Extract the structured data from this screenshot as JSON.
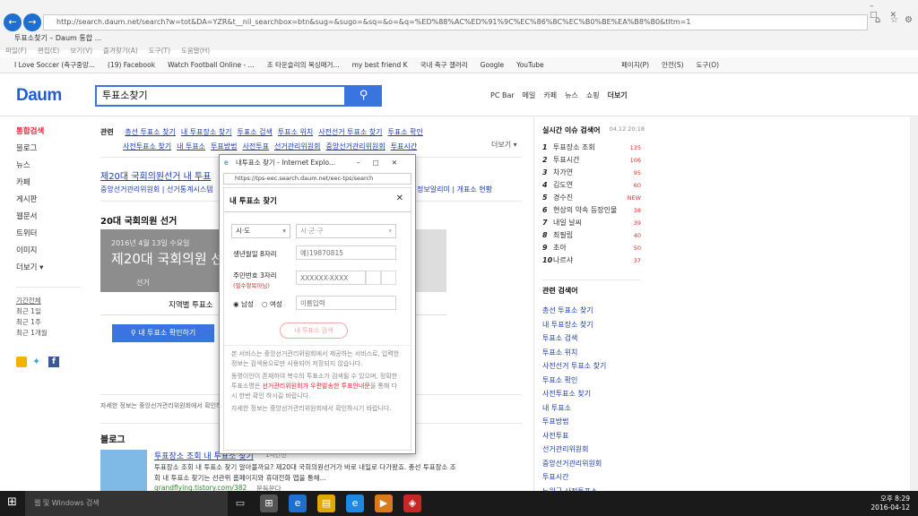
{
  "browser": {
    "url": "http://search.daum.net/search?w=tot&DA=YZR&t__nil_searchbox=btn&sug=&sugo=&sq=&o=&q=%ED%88%AC%ED%91%9C%EC%86%8C%EC%B0%BE%EA%B8%B0&tltm=1",
    "tab_title": "투표소찾기 – Daum 통합 ...",
    "menu": [
      "파일(F)",
      "편집(E)",
      "보기(V)",
      "즐겨찾기(A)",
      "도구(T)",
      "도움말(H)"
    ],
    "favorites": [
      "I Love Soccer (축구중앙...",
      "(19) Facebook",
      "Watch Football Online - ...",
      "조 타운슬리의 복싱매거...",
      "my best friend K",
      "국내 축구 갤러리",
      "Google",
      "YouTube"
    ],
    "commandbar": [
      "페이지(P)",
      "안전(S)",
      "도구(O)"
    ]
  },
  "daum": {
    "logo": "Daum",
    "query": "투표소찾기",
    "topnav": [
      "PC Bar",
      "메일",
      "카페",
      "뉴스",
      "쇼핑",
      "더보기"
    ],
    "leftnav": [
      "통합검색",
      "블로그",
      "뉴스",
      "카페",
      "게시판",
      "웹문서",
      "트위터",
      "이미지",
      "더보기"
    ],
    "period_title": "기간전체",
    "periods": [
      "최근 1일",
      "최근 1주",
      "최근 1개월"
    ],
    "related_label": "관련",
    "related_row1": [
      "총선 투표소 찾기",
      "내 투표장소 찾기",
      "투표소 검색",
      "투표소 위치",
      "사전선거 투표소 찾기",
      "투표소 확인"
    ],
    "related_row2": [
      "사전투표소 찾기",
      "내 투표소",
      "투표방법",
      "사전투표",
      "선거관리위원회",
      "중앙선거관리위원회",
      "투표시간"
    ],
    "more": "더보기",
    "result_title": "제20대 국회의원선거 내 투표",
    "result_sub": "중앙선거관리위원회 | 선거통계시스템",
    "result_sub_right": "정보알리미 | 개표소 현황",
    "section_title": "20대 국회의원 선거",
    "banner_date": "2016년 4월 13일 수요일",
    "banner_title": "제20대 국회의원 선",
    "banner_tab": "선거",
    "tab_local": "지역별 투표소",
    "find_btn": "내 투표소 확인하기",
    "footnote": "자세한 정보는 중앙선거관리위원회에서 확인하",
    "blog_title": "블로그",
    "blog_link": "투표장소 조회 내 투표소 찾기",
    "blog_meta": "1시간전",
    "blog_text1": "투표장소 조회 내 투표소 찾기 알아볼까요? 제20대 국회의원선거가 바로 내일로 다가왔죠. 총선 투표장소 조",
    "blog_text2": "회 내 투표소 찾기는 선관위 홈페이지와 휴대전화 앱을 통해...",
    "blog_url": "grandflying.tistory.com/382",
    "blog_more": "문득문다"
  },
  "realtime": {
    "title": "실시간 이슈 검색어",
    "time": "04.12  20:18",
    "items": [
      {
        "rank": "1",
        "word": "투표장소 조회",
        "val": "135"
      },
      {
        "rank": "2",
        "word": "투표시간",
        "val": "106"
      },
      {
        "rank": "3",
        "word": "차가연",
        "val": "95"
      },
      {
        "rank": "4",
        "word": "김도연",
        "val": "60"
      },
      {
        "rank": "5",
        "word": "경수진",
        "val": "NEW"
      },
      {
        "rank": "6",
        "word": "현상의 약속 등장인물",
        "val": "38"
      },
      {
        "rank": "7",
        "word": "내일 날씨",
        "val": "39"
      },
      {
        "rank": "8",
        "word": "최필립",
        "val": "40"
      },
      {
        "rank": "9",
        "word": "초아",
        "val": "50"
      },
      {
        "rank": "10",
        "word": "나르샤",
        "val": "37"
      }
    ],
    "related_title": "관련 검색어",
    "related": [
      "총선 투표소 찾기",
      "내 투표장소 찾기",
      "투표소 검색",
      "투표소 위치",
      "사전선거 투표소 찾기",
      "투표소 확인",
      "사전투표소 찾기",
      "내 투표소",
      "투표방법",
      "사전투표",
      "선거관리위원회",
      "중앙선거관리위원회",
      "투표시간",
      "노원구 사전투표소"
    ]
  },
  "popup": {
    "window_title": "내투표소 찾기 - Internet Explo...",
    "url": "https://tps-eec.search.daum.net/eec-tps/search",
    "heading": "내 투표소 찾기",
    "sido": "시·도",
    "sigungu": "시·군·구",
    "birth_label": "생년월일 8자리",
    "birth_ph": "예)19870815",
    "id_label": "주민번호 3자리",
    "id_note": "(필수항목아님)",
    "id_ph": "XXXXXX-XXXX",
    "male": "남성",
    "female": "여성",
    "name_ph": "이름입력",
    "search_btn": "내 투표소 검색",
    "desc1": "본 서비스는 중앙선거관리위원회에서 제공하는 서비스로, 입력한 정보는 검색용으로만 사용되어 저장되지 않습니다.",
    "desc2a": "동명이인이 존재하여 복수의 투표소가 검색될 수 있으며, 정확한 투표소명은 ",
    "desc2b": "선거관리위원회가 우편발송한 투표안내문",
    "desc2c": "을 통해 다시 한번 확인 하시길 바랍니다.",
    "desc3": "자세한 정보는 중앙선거관리위원회에서 확인하시기 바랍니다."
  },
  "taskbar": {
    "search": "웹 및 Windows 검색",
    "time": "오후 8:29",
    "date": "2016-04-12"
  }
}
